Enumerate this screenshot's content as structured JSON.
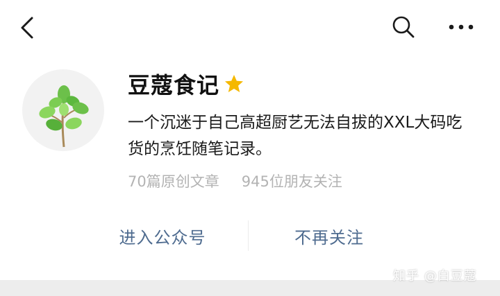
{
  "topbar": {
    "back_icon": "back-arrow-icon",
    "search_icon": "search-icon",
    "more_icon": "more-dots-icon"
  },
  "account": {
    "name": "豆蔻食记",
    "badge_icon": "star-icon",
    "badge_color": "#f5b800",
    "avatar": "plant-avatar",
    "description": "一个沉迷于自己高超厨艺无法自拔的XXL大码吃货的烹饪随笔记录。",
    "articles": "70篇原创文章",
    "followers": "945位朋友关注"
  },
  "actions": {
    "enter_label": "进入公众号",
    "unfollow_label": "不再关注",
    "accent_color": "#4e6b8f"
  },
  "watermark": "知乎 @白豆蔻"
}
